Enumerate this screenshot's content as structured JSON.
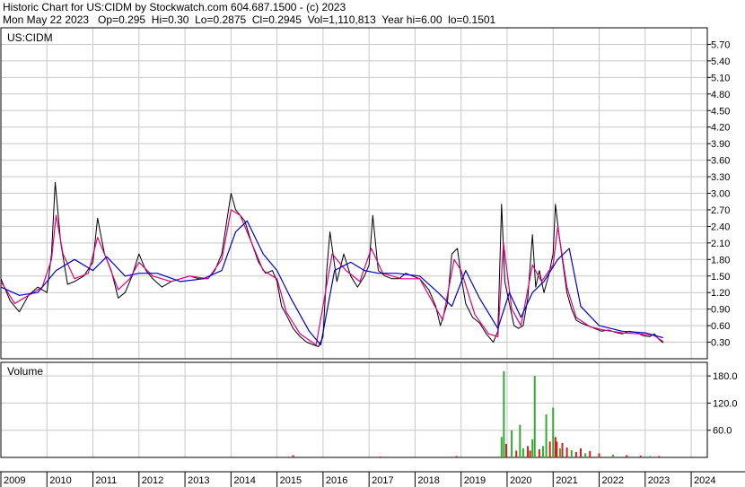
{
  "header": {
    "line1": "Historic Chart for US:CIDM by Stockwatch.com 604.687.1500 - (c) 2023",
    "line2": "Mon May 22 2023   Op=0.295  Hi=0.30  Lo=0.2875  Cl=0.2945  Vol=1,110,813  Year hi=6.00  lo=0.1501"
  },
  "chart_data": [
    {
      "type": "line",
      "title": "US:CIDM",
      "y_ticks": [
        "0.30",
        "0.60",
        "0.90",
        "1.20",
        "1.50",
        "1.80",
        "2.10",
        "2.40",
        "2.70",
        "3.00",
        "3.30",
        "3.60",
        "3.90",
        "4.20",
        "4.50",
        "4.80",
        "5.10",
        "5.40",
        "5.70"
      ],
      "ylim": [
        0,
        6.0
      ],
      "x_ticks": [
        "2009",
        "2010",
        "2011",
        "2012",
        "2013",
        "2014",
        "2015",
        "2016",
        "2017",
        "2018",
        "2019",
        "2020",
        "2021",
        "2022",
        "2023",
        "2024"
      ],
      "xlim": [
        2009.0,
        2024.35
      ],
      "grid": true,
      "colors": {
        "price": "#000000",
        "ma_short": "#e0007f",
        "ma_long": "#0000cc"
      },
      "series": [
        {
          "values": [
            [
              2009.0,
              1.45
            ],
            [
              2009.2,
              1.05
            ],
            [
              2009.4,
              0.85
            ],
            [
              2009.6,
              1.15
            ],
            [
              2009.8,
              1.3
            ],
            [
              2010.0,
              1.2
            ],
            [
              2010.1,
              1.9
            ],
            [
              2010.18,
              3.2
            ],
            [
              2010.3,
              2.1
            ],
            [
              2010.45,
              1.35
            ],
            [
              2010.6,
              1.4
            ],
            [
              2010.8,
              1.5
            ],
            [
              2011.0,
              1.75
            ],
            [
              2011.1,
              2.55
            ],
            [
              2011.25,
              1.9
            ],
            [
              2011.4,
              1.6
            ],
            [
              2011.55,
              1.1
            ],
            [
              2011.7,
              1.2
            ],
            [
              2011.85,
              1.5
            ],
            [
              2012.0,
              1.9
            ],
            [
              2012.15,
              1.6
            ],
            [
              2012.3,
              1.45
            ],
            [
              2012.5,
              1.3
            ],
            [
              2012.7,
              1.4
            ],
            [
              2012.9,
              1.45
            ],
            [
              2013.1,
              1.5
            ],
            [
              2013.3,
              1.45
            ],
            [
              2013.5,
              1.45
            ],
            [
              2013.65,
              1.6
            ],
            [
              2013.8,
              1.9
            ],
            [
              2013.9,
              2.45
            ],
            [
              2014.0,
              3.0
            ],
            [
              2014.1,
              2.7
            ],
            [
              2014.2,
              2.6
            ],
            [
              2014.3,
              2.5
            ],
            [
              2014.45,
              2.1
            ],
            [
              2014.6,
              1.75
            ],
            [
              2014.75,
              1.55
            ],
            [
              2014.9,
              1.6
            ],
            [
              2015.0,
              1.4
            ],
            [
              2015.1,
              0.95
            ],
            [
              2015.2,
              0.8
            ],
            [
              2015.35,
              0.55
            ],
            [
              2015.5,
              0.4
            ],
            [
              2015.65,
              0.3
            ],
            [
              2015.8,
              0.25
            ],
            [
              2015.9,
              0.22
            ],
            [
              2016.0,
              0.4
            ],
            [
              2016.08,
              1.6
            ],
            [
              2016.15,
              2.3
            ],
            [
              2016.3,
              1.4
            ],
            [
              2016.45,
              1.9
            ],
            [
              2016.6,
              1.5
            ],
            [
              2016.75,
              1.3
            ],
            [
              2016.9,
              1.5
            ],
            [
              2017.0,
              1.7
            ],
            [
              2017.08,
              2.6
            ],
            [
              2017.2,
              1.6
            ],
            [
              2017.35,
              1.5
            ],
            [
              2017.5,
              1.45
            ],
            [
              2017.65,
              1.45
            ],
            [
              2017.8,
              1.55
            ],
            [
              2017.95,
              1.5
            ],
            [
              2018.1,
              1.45
            ],
            [
              2018.3,
              1.25
            ],
            [
              2018.45,
              0.95
            ],
            [
              2018.55,
              0.6
            ],
            [
              2018.7,
              1.0
            ],
            [
              2018.8,
              1.9
            ],
            [
              2018.92,
              2.0
            ],
            [
              2019.0,
              1.5
            ],
            [
              2019.1,
              1.0
            ],
            [
              2019.25,
              0.75
            ],
            [
              2019.4,
              0.65
            ],
            [
              2019.55,
              0.45
            ],
            [
              2019.7,
              0.3
            ],
            [
              2019.8,
              0.5
            ],
            [
              2019.88,
              2.8
            ],
            [
              2019.95,
              1.4
            ],
            [
              2020.05,
              1.0
            ],
            [
              2020.15,
              0.6
            ],
            [
              2020.25,
              0.55
            ],
            [
              2020.35,
              0.6
            ],
            [
              2020.45,
              1.1
            ],
            [
              2020.55,
              2.25
            ],
            [
              2020.62,
              1.3
            ],
            [
              2020.7,
              1.6
            ],
            [
              2020.8,
              1.2
            ],
            [
              2020.9,
              1.5
            ],
            [
              2021.0,
              1.9
            ],
            [
              2021.05,
              2.8
            ],
            [
              2021.12,
              2.3
            ],
            [
              2021.2,
              1.8
            ],
            [
              2021.3,
              1.2
            ],
            [
              2021.4,
              0.9
            ],
            [
              2021.5,
              0.7
            ],
            [
              2021.6,
              0.65
            ],
            [
              2021.75,
              0.6
            ],
            [
              2021.9,
              0.55
            ],
            [
              2022.05,
              0.5
            ],
            [
              2022.2,
              0.52
            ],
            [
              2022.35,
              0.48
            ],
            [
              2022.5,
              0.45
            ],
            [
              2022.65,
              0.5
            ],
            [
              2022.8,
              0.48
            ],
            [
              2022.95,
              0.42
            ],
            [
              2023.1,
              0.4
            ],
            [
              2023.2,
              0.45
            ],
            [
              2023.3,
              0.35
            ],
            [
              2023.39,
              0.29
            ]
          ]
        },
        {
          "values": [
            [
              2009.0,
              1.4
            ],
            [
              2009.3,
              1.0
            ],
            [
              2009.6,
              1.15
            ],
            [
              2009.9,
              1.3
            ],
            [
              2010.1,
              1.8
            ],
            [
              2010.2,
              2.6
            ],
            [
              2010.35,
              1.9
            ],
            [
              2010.6,
              1.45
            ],
            [
              2010.9,
              1.55
            ],
            [
              2011.1,
              2.2
            ],
            [
              2011.3,
              1.8
            ],
            [
              2011.55,
              1.25
            ],
            [
              2011.8,
              1.45
            ],
            [
              2012.0,
              1.75
            ],
            [
              2012.3,
              1.5
            ],
            [
              2012.7,
              1.4
            ],
            [
              2013.1,
              1.5
            ],
            [
              2013.5,
              1.45
            ],
            [
              2013.8,
              1.8
            ],
            [
              2014.0,
              2.7
            ],
            [
              2014.2,
              2.6
            ],
            [
              2014.45,
              2.1
            ],
            [
              2014.7,
              1.6
            ],
            [
              2015.0,
              1.45
            ],
            [
              2015.2,
              0.85
            ],
            [
              2015.5,
              0.45
            ],
            [
              2015.85,
              0.25
            ],
            [
              2016.05,
              1.2
            ],
            [
              2016.2,
              1.9
            ],
            [
              2016.5,
              1.6
            ],
            [
              2016.8,
              1.4
            ],
            [
              2017.05,
              2.0
            ],
            [
              2017.3,
              1.55
            ],
            [
              2017.7,
              1.45
            ],
            [
              2018.1,
              1.45
            ],
            [
              2018.4,
              1.0
            ],
            [
              2018.6,
              0.7
            ],
            [
              2018.85,
              1.8
            ],
            [
              2019.0,
              1.6
            ],
            [
              2019.3,
              0.8
            ],
            [
              2019.6,
              0.45
            ],
            [
              2019.8,
              0.4
            ],
            [
              2019.92,
              2.1
            ],
            [
              2020.1,
              0.9
            ],
            [
              2020.3,
              0.6
            ],
            [
              2020.55,
              1.7
            ],
            [
              2020.75,
              1.4
            ],
            [
              2021.0,
              1.7
            ],
            [
              2021.1,
              2.4
            ],
            [
              2021.3,
              1.3
            ],
            [
              2021.5,
              0.75
            ],
            [
              2021.8,
              0.58
            ],
            [
              2022.1,
              0.52
            ],
            [
              2022.5,
              0.47
            ],
            [
              2022.9,
              0.45
            ],
            [
              2023.2,
              0.42
            ],
            [
              2023.39,
              0.31
            ]
          ]
        },
        {
          "values": [
            [
              2009.0,
              1.3
            ],
            [
              2009.4,
              1.15
            ],
            [
              2009.8,
              1.2
            ],
            [
              2010.2,
              1.6
            ],
            [
              2010.6,
              1.8
            ],
            [
              2011.0,
              1.6
            ],
            [
              2011.3,
              1.85
            ],
            [
              2011.7,
              1.5
            ],
            [
              2012.0,
              1.55
            ],
            [
              2012.4,
              1.55
            ],
            [
              2012.9,
              1.4
            ],
            [
              2013.4,
              1.45
            ],
            [
              2013.8,
              1.6
            ],
            [
              2014.1,
              2.3
            ],
            [
              2014.35,
              2.5
            ],
            [
              2014.7,
              1.9
            ],
            [
              2015.0,
              1.6
            ],
            [
              2015.3,
              1.1
            ],
            [
              2015.7,
              0.5
            ],
            [
              2015.95,
              0.25
            ],
            [
              2016.25,
              1.6
            ],
            [
              2016.6,
              1.75
            ],
            [
              2016.9,
              1.6
            ],
            [
              2017.2,
              1.55
            ],
            [
              2017.6,
              1.55
            ],
            [
              2018.1,
              1.5
            ],
            [
              2018.5,
              1.2
            ],
            [
              2018.8,
              0.95
            ],
            [
              2019.1,
              1.6
            ],
            [
              2019.4,
              1.1
            ],
            [
              2019.8,
              0.55
            ],
            [
              2020.05,
              1.2
            ],
            [
              2020.3,
              0.75
            ],
            [
              2020.55,
              1.2
            ],
            [
              2020.8,
              1.4
            ],
            [
              2021.1,
              1.8
            ],
            [
              2021.35,
              2.0
            ],
            [
              2021.6,
              0.95
            ],
            [
              2022.0,
              0.6
            ],
            [
              2022.5,
              0.5
            ],
            [
              2023.0,
              0.47
            ],
            [
              2023.39,
              0.38
            ]
          ]
        }
      ]
    },
    {
      "type": "bar",
      "title": "Volume",
      "y_ticks": [
        "60.0",
        "120.0",
        "180.0"
      ],
      "ylim": [
        0,
        210
      ],
      "colors": {
        "up": "#33aa33",
        "down": "#cc2222"
      },
      "x": [
        2015.35,
        2016.0,
        2017.25,
        2018.9,
        2019.88,
        2019.93,
        2019.98,
        2020.1,
        2020.2,
        2020.28,
        2020.35,
        2020.45,
        2020.5,
        2020.55,
        2020.6,
        2020.7,
        2020.78,
        2020.85,
        2020.93,
        2021.0,
        2021.05,
        2021.08,
        2021.15,
        2021.2,
        2021.3,
        2021.4,
        2021.5,
        2021.6,
        2021.7,
        2021.8,
        2022.0,
        2022.3,
        2022.6,
        2022.9,
        2023.1,
        2023.3
      ],
      "values": [
        5,
        2,
        2,
        3,
        45,
        190,
        30,
        60,
        15,
        72,
        20,
        25,
        15,
        40,
        180,
        18,
        25,
        95,
        35,
        110,
        45,
        35,
        20,
        32,
        22,
        16,
        12,
        20,
        9,
        14,
        9,
        6,
        5,
        4,
        3,
        3
      ]
    }
  ]
}
